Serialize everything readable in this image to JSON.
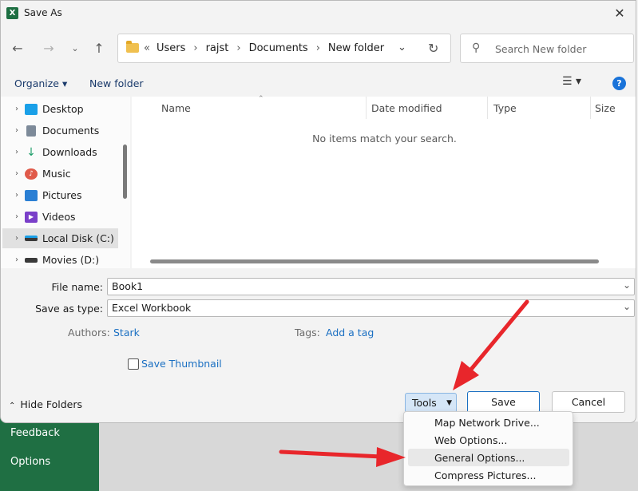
{
  "background": {
    "menu_items": [
      "Feedback",
      "Options"
    ]
  },
  "window": {
    "title": "Save As",
    "app_icon_letter": "X"
  },
  "nav": {
    "breadcrumb_prefix": "«",
    "crumbs": [
      "Users",
      "rajst",
      "Documents",
      "New folder"
    ],
    "search_placeholder": "Search New folder"
  },
  "commands": {
    "organize": "Organize ▾",
    "new_folder": "New folder",
    "help": "?"
  },
  "sidebar": {
    "items": [
      {
        "label": "Desktop",
        "icon": "desktop-icon",
        "color": "#1aa0e8"
      },
      {
        "label": "Documents",
        "icon": "documents-icon",
        "color": "#7d8a99"
      },
      {
        "label": "Downloads",
        "icon": "download-icon",
        "color": "#1f9e6a"
      },
      {
        "label": "Music",
        "icon": "music-icon",
        "color": "#e05a4a"
      },
      {
        "label": "Pictures",
        "icon": "pictures-icon",
        "color": "#2a7fd4"
      },
      {
        "label": "Videos",
        "icon": "videos-icon",
        "color": "#7a3fc9"
      },
      {
        "label": "Local Disk (C:)",
        "icon": "drive-icon",
        "color": "#3a3a3a"
      },
      {
        "label": "Movies (D:)",
        "icon": "drive-icon",
        "color": "#3a3a3a"
      }
    ]
  },
  "files": {
    "columns": [
      "Name",
      "Date modified",
      "Type",
      "Size"
    ],
    "empty_message": "No items match your search."
  },
  "form": {
    "file_name_label": "File name:",
    "file_name_value": "Book1",
    "save_type_label": "Save as type:",
    "save_type_value": "Excel Workbook",
    "authors_label": "Authors:",
    "authors_value": "Stark",
    "tags_label": "Tags:",
    "tags_value": "Add a tag",
    "thumbnail_label": "Save Thumbnail"
  },
  "footer": {
    "hide_folders": "Hide Folders",
    "tools": "Tools",
    "save": "Save",
    "cancel": "Cancel"
  },
  "tools_menu": {
    "items": [
      "Map Network Drive...",
      "Web Options...",
      "General Options...",
      "Compress Pictures..."
    ],
    "highlighted": "General Options..."
  },
  "colors": {
    "accent": "#1a6fc2",
    "excel_green": "#1f6f43",
    "annotation_red": "#e8262b"
  }
}
